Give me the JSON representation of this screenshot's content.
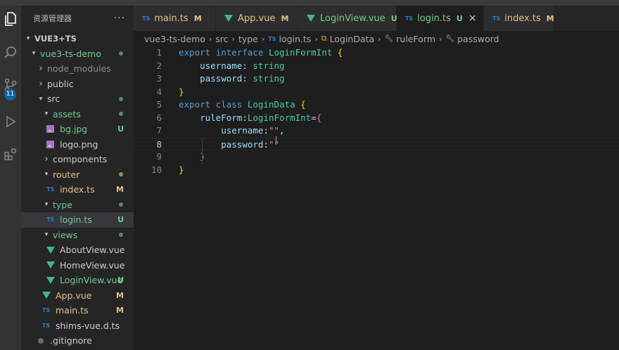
{
  "explorer": {
    "title": "资源管理器",
    "more": "···",
    "workspace": "VUE3+TS",
    "items": [
      {
        "label": "vue3-ts-demo",
        "kind": "folder",
        "open": true,
        "depth": 1,
        "status": "dot",
        "color": "green"
      },
      {
        "label": "node_modules",
        "kind": "folder",
        "open": false,
        "depth": 2,
        "status": "",
        "color": "grey"
      },
      {
        "label": "public",
        "kind": "folder",
        "open": false,
        "depth": 2,
        "status": "",
        "color": "white"
      },
      {
        "label": "src",
        "kind": "folder",
        "open": true,
        "depth": 2,
        "status": "dot",
        "color": "white"
      },
      {
        "label": "assets",
        "kind": "folder",
        "open": true,
        "depth": 3,
        "status": "dot",
        "color": "green"
      },
      {
        "label": "bg.jpg",
        "kind": "image",
        "depth": 4,
        "status": "U",
        "color": "green"
      },
      {
        "label": "logo.png",
        "kind": "image",
        "depth": 4,
        "status": "",
        "color": "white"
      },
      {
        "label": "components",
        "kind": "folder",
        "open": false,
        "depth": 3,
        "status": "",
        "color": "white"
      },
      {
        "label": "router",
        "kind": "folder",
        "open": true,
        "depth": 3,
        "status": "dot",
        "color": "gold"
      },
      {
        "label": "index.ts",
        "kind": "ts",
        "depth": 4,
        "status": "M",
        "color": "gold"
      },
      {
        "label": "type",
        "kind": "folder",
        "open": true,
        "depth": 3,
        "status": "dot",
        "color": "green"
      },
      {
        "label": "login.ts",
        "kind": "ts",
        "depth": 4,
        "status": "U",
        "color": "green",
        "selected": true
      },
      {
        "label": "views",
        "kind": "folder",
        "open": true,
        "depth": 3,
        "status": "dot",
        "color": "green"
      },
      {
        "label": "AboutView.vue",
        "kind": "vue",
        "depth": 4,
        "status": "",
        "color": "white"
      },
      {
        "label": "HomeView.vue",
        "kind": "vue",
        "depth": 4,
        "status": "",
        "color": "white"
      },
      {
        "label": "LoginView.vue",
        "kind": "vue",
        "depth": 4,
        "status": "U",
        "color": "green"
      },
      {
        "label": "App.vue",
        "kind": "vue",
        "depth": 3,
        "status": "M",
        "color": "gold"
      },
      {
        "label": "main.ts",
        "kind": "ts",
        "depth": 3,
        "status": "M",
        "color": "gold"
      },
      {
        "label": "shims-vue.d.ts",
        "kind": "ts",
        "depth": 3,
        "status": "",
        "color": "white"
      },
      {
        "label": ".gitignore",
        "kind": "git",
        "depth": 2,
        "status": "",
        "color": "white"
      }
    ]
  },
  "activity": {
    "icons": [
      "files-icon",
      "search-icon",
      "source-control-icon",
      "run-debug-icon",
      "extensions-icon"
    ],
    "scm_badge": "11"
  },
  "tabs": [
    {
      "label": "main.ts",
      "kind": "ts",
      "status": "M",
      "color": "gold",
      "active": false
    },
    {
      "label": "App.vue",
      "kind": "vue",
      "status": "M",
      "color": "gold",
      "active": false
    },
    {
      "label": "LoginView.vue",
      "kind": "vue",
      "status": "U",
      "color": "green",
      "active": false
    },
    {
      "label": "login.ts",
      "kind": "ts",
      "status": "U",
      "color": "green",
      "active": true
    },
    {
      "label": "index.ts",
      "kind": "ts",
      "status": "M",
      "color": "gold",
      "active": false
    }
  ],
  "tab_close": "×",
  "breadcrumb": {
    "parts": [
      "vue3-ts-demo",
      "src",
      "type",
      "login.ts",
      "LoginData",
      "ruleForm",
      "password"
    ],
    "sep": "›"
  },
  "code": {
    "current_line": 8,
    "lines": [
      {
        "n": "1",
        "tokens": [
          [
            "kw",
            "export"
          ],
          [
            "pun",
            " "
          ],
          [
            "kw",
            "interface"
          ],
          [
            "pun",
            " "
          ],
          [
            "cls",
            "LoginFormInt"
          ],
          [
            "pun",
            " "
          ],
          [
            "br1",
            "{"
          ]
        ]
      },
      {
        "n": "2",
        "tokens": [
          [
            "pun",
            "    "
          ],
          [
            "prop",
            "username"
          ],
          [
            "pun",
            ": "
          ],
          [
            "cls",
            "string"
          ]
        ]
      },
      {
        "n": "3",
        "tokens": [
          [
            "pun",
            "    "
          ],
          [
            "prop",
            "password"
          ],
          [
            "pun",
            ": "
          ],
          [
            "cls",
            "string"
          ]
        ]
      },
      {
        "n": "4",
        "tokens": [
          [
            "br1",
            "}"
          ]
        ]
      },
      {
        "n": "5",
        "tokens": [
          [
            "kw",
            "export"
          ],
          [
            "pun",
            " "
          ],
          [
            "kw",
            "class"
          ],
          [
            "pun",
            " "
          ],
          [
            "cls",
            "LoginData"
          ],
          [
            "pun",
            " "
          ],
          [
            "br1",
            "{"
          ]
        ]
      },
      {
        "n": "6",
        "tokens": [
          [
            "pun",
            "    "
          ],
          [
            "prop",
            "ruleForm"
          ],
          [
            "pun",
            ":"
          ],
          [
            "cls",
            "LoginFormInt"
          ],
          [
            "pun",
            "="
          ],
          [
            "br2",
            "{"
          ]
        ]
      },
      {
        "n": "7",
        "tokens": [
          [
            "pun",
            "        "
          ],
          [
            "prop",
            "username"
          ],
          [
            "pun",
            ":"
          ],
          [
            "str",
            "\"\""
          ],
          [
            "pun",
            ","
          ]
        ]
      },
      {
        "n": "8",
        "tokens": [
          [
            "pun",
            "        "
          ],
          [
            "prop",
            "password"
          ],
          [
            "pun",
            ":"
          ],
          [
            "str",
            "\"\""
          ]
        ]
      },
      {
        "n": "9",
        "tokens": [
          [
            "pun",
            "    "
          ],
          [
            "br2",
            "}"
          ]
        ]
      },
      {
        "n": "10",
        "tokens": [
          [
            "br1",
            "}"
          ]
        ]
      }
    ]
  },
  "colors": {
    "green": "#73c991",
    "gold": "#e2c08d",
    "white": "#cccccc",
    "grey": "#8c8c8c",
    "ts_blue": "#3178c6",
    "vue_green": "#41b883"
  }
}
